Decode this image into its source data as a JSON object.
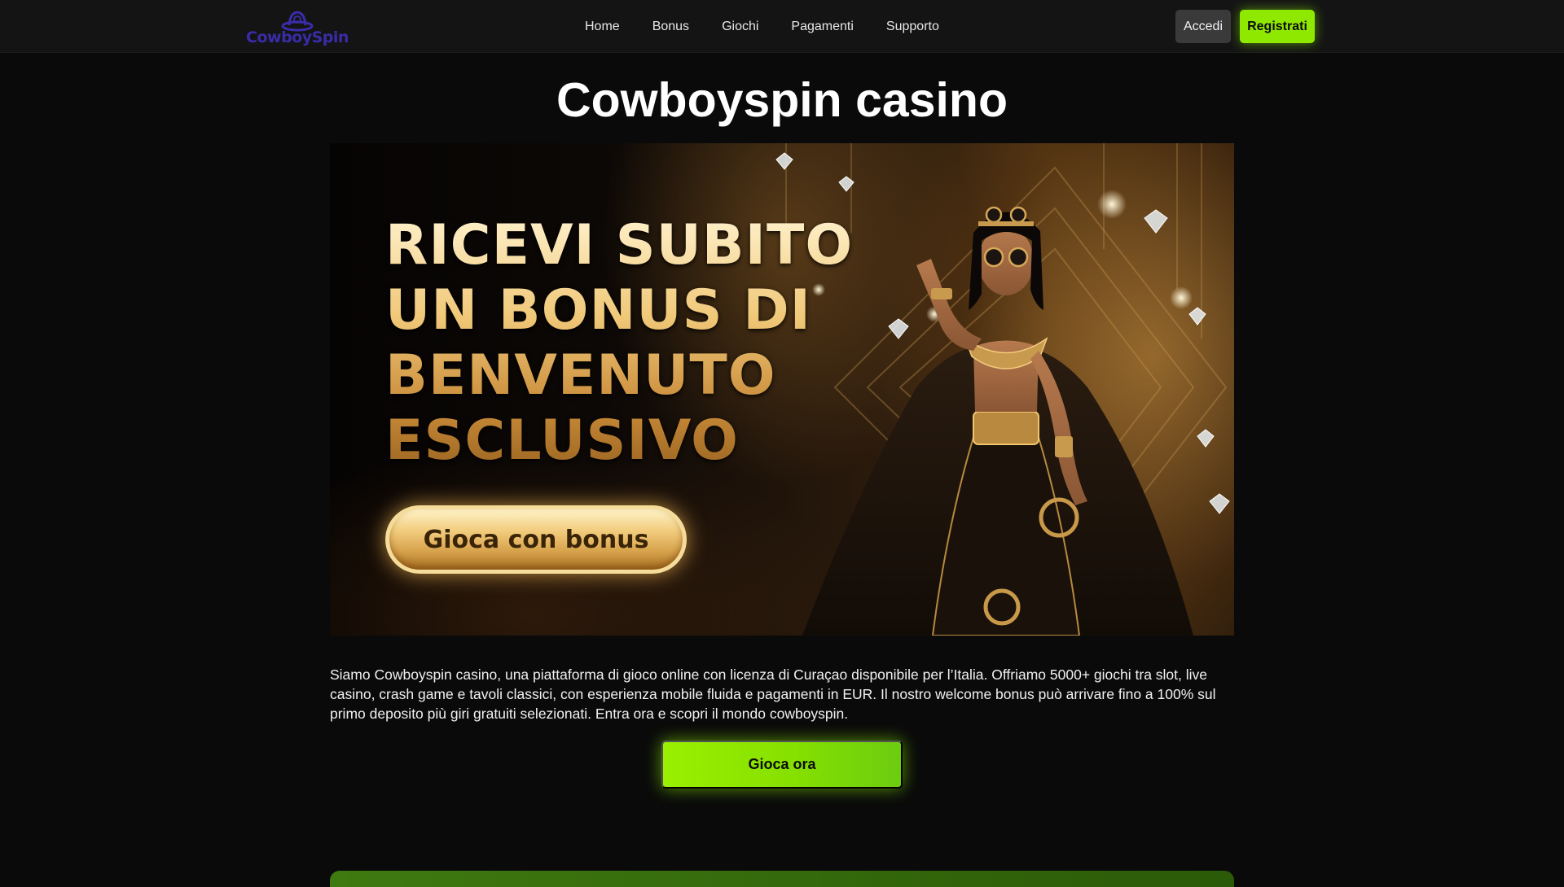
{
  "header": {
    "logo_text": "CowboySpin",
    "nav": [
      "Home",
      "Bonus",
      "Giochi",
      "Pagamenti",
      "Supporto"
    ],
    "login_label": "Accedi",
    "register_label": "Registrati"
  },
  "main": {
    "title": "Cowboyspin casino",
    "banner": {
      "headline": [
        "RICEVI SUBITO",
        "UN BONUS DI",
        "BENVENUTO",
        "ESCLUSIVO"
      ],
      "cta_label": "Gioca con bonus"
    },
    "description": "Siamo Cowboyspin casino, una piattaforma di gioco online con licenza di Curaçao disponibile per l’Italia. Offriamo 5000+ giochi tra slot, live casino, crash game e tavoli classici, con esperienza mobile fluida e pagamenti in EUR. Il nostro welcome bonus può arrivare fino a 100% sul primo deposito più giri gratuiti selezionati. Entra ora e scopri il mondo cowboyspin.",
    "play_label": "Gioca ora"
  },
  "colors": {
    "accent": "#8fe800",
    "background": "#0a0a0a",
    "header": "#141414",
    "gold": "#e7b45c"
  }
}
